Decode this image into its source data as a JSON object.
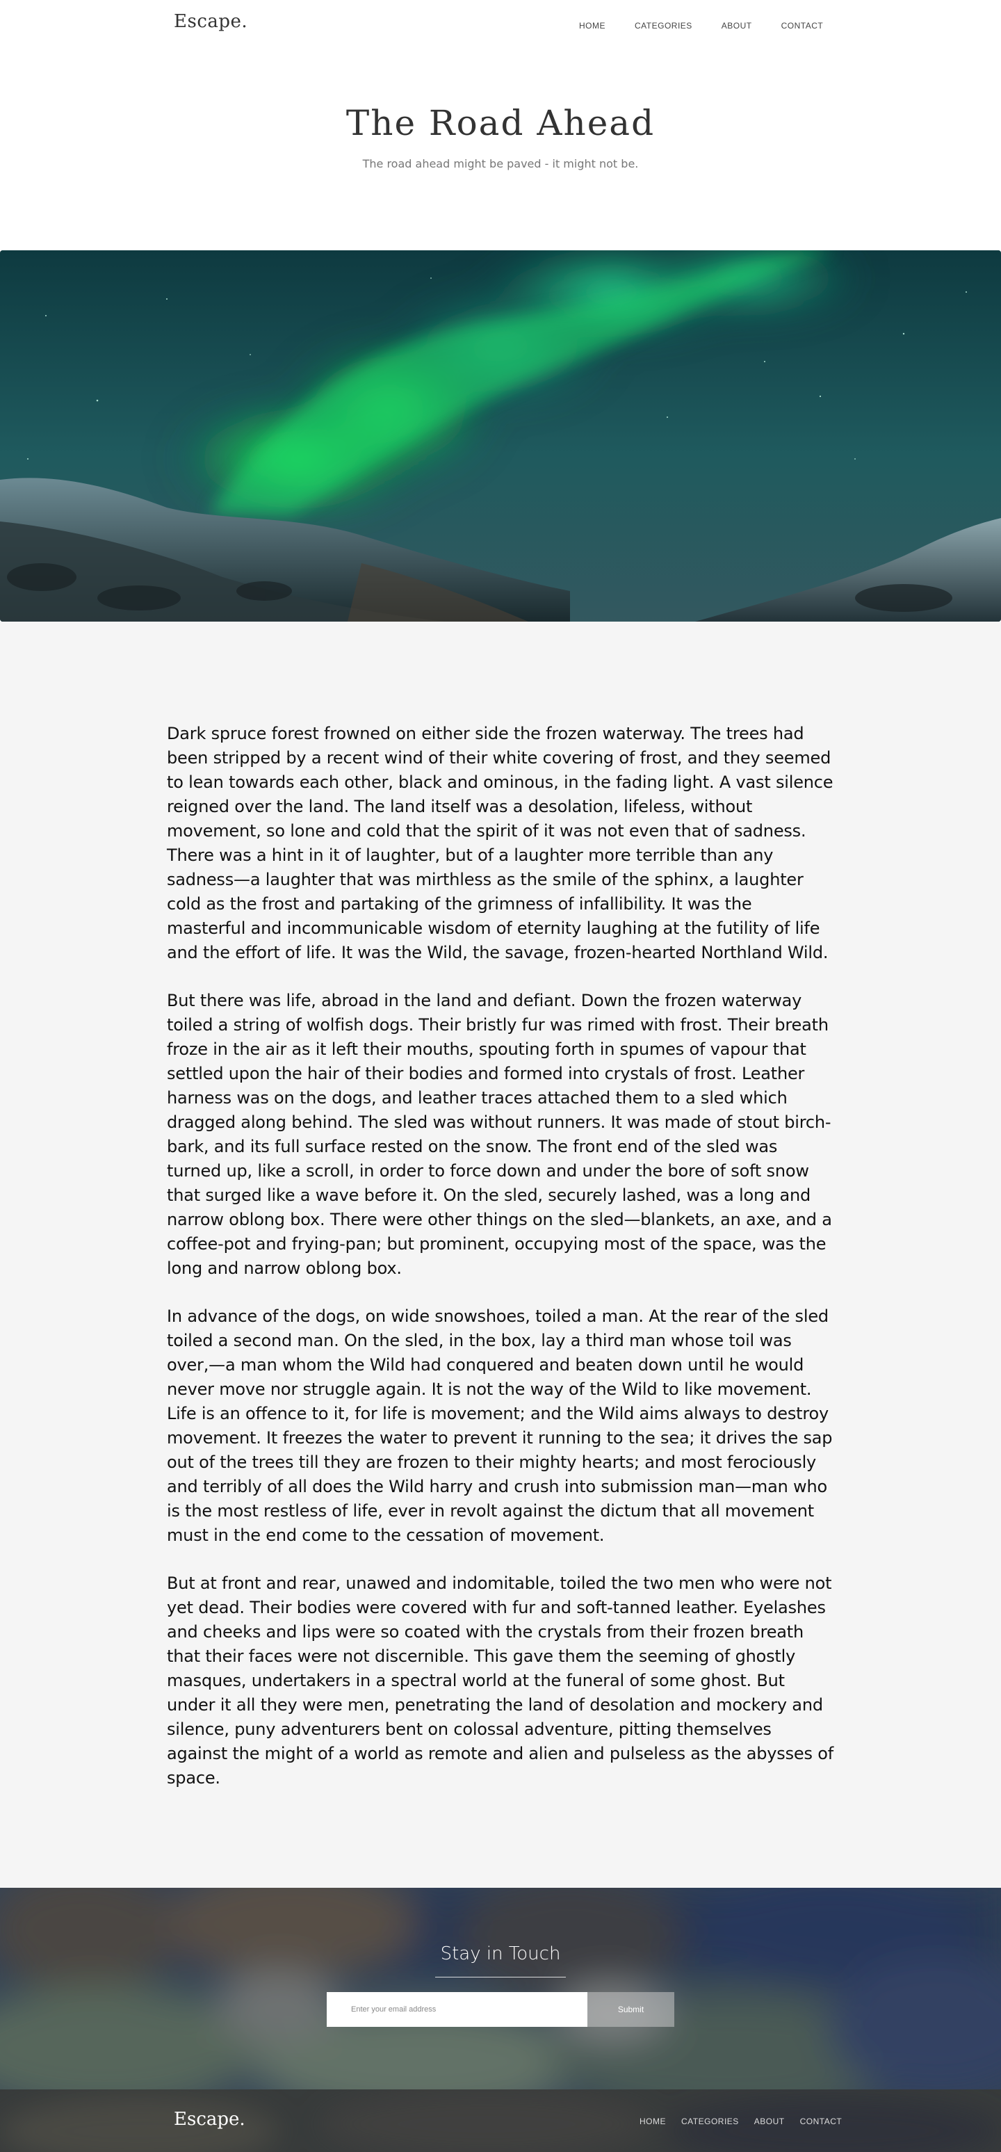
{
  "header": {
    "logo": "Escape.",
    "nav": [
      "HOME",
      "CATEGORIES",
      "ABOUT",
      "CONTACT"
    ]
  },
  "hero": {
    "title": "The Road Ahead",
    "subtitle": "The road ahead might be paved - it might not be."
  },
  "article": {
    "paragraphs": [
      "Dark spruce forest frowned on either side the frozen waterway. The trees had been stripped by a recent wind of their white covering of frost, and they seemed to lean towards each other, black and ominous, in the fading light. A vast silence reigned over the land. The land itself was a desolation, lifeless, without movement, so lone and cold that the spirit of it was not even that of sadness. There was a hint in it of laughter, but of a laughter more terrible than any sadness—a laughter that was mirthless as the smile of the sphinx, a laughter cold as the frost and partaking of the grimness of infallibility. It was the masterful and incommunicable wisdom of eternity laughing at the futility of life and the effort of life. It was the Wild, the savage, frozen-hearted Northland Wild.",
      "But there was life, abroad in the land and defiant. Down the frozen waterway toiled a string of wolfish dogs. Their bristly fur was rimed with frost. Their breath froze in the air as it left their mouths, spouting forth in spumes of vapour that settled upon the hair of their bodies and formed into crystals of frost. Leather harness was on the dogs, and leather traces attached them to a sled which dragged along behind. The sled was without runners. It was made of stout birch-bark, and its full surface rested on the snow. The front end of the sled was turned up, like a scroll, in order to force down and under the bore of soft snow that surged like a wave before it. On the sled, securely lashed, was a long and narrow oblong box. There were other things on the sled—blankets, an axe, and a coffee-pot and frying-pan; but prominent, occupying most of the space, was the long and narrow oblong box.",
      "In advance of the dogs, on wide snowshoes, toiled a man. At the rear of the sled toiled a second man. On the sled, in the box, lay a third man whose toil was over,—a man whom the Wild had conquered and beaten down until he would never move nor struggle again. It is not the way of the Wild to like movement. Life is an offence to it, for life is movement; and the Wild aims always to destroy movement. It freezes the water to prevent it running to the sea; it drives the sap out of the trees till they are frozen to their mighty hearts; and most ferociously and terribly of all does the Wild harry and crush into submission man—man who is the most restless of life, ever in revolt against the dictum that all movement must in the end come to the cessation of movement.",
      "But at front and rear, unawed and indomitable, toiled the two men who were not yet dead. Their bodies were covered with fur and soft-tanned leather. Eyelashes and cheeks and lips were so coated with the crystals from their frozen breath that their faces were not discernible. This gave them the seeming of ghostly masques, undertakers in a spectral world at the funeral of some ghost. But under it all they were men, penetrating the land of desolation and mockery and silence, puny adventurers bent on colossal adventure, pitting themselves against the might of a world as remote and alien and pulseless as the abysses of space."
    ]
  },
  "newsletter": {
    "title": "Stay in Touch",
    "email_placeholder": "Enter your email address",
    "submit_label": "Submit"
  },
  "footer": {
    "logo": "Escape.",
    "nav": [
      "HOME",
      "CATEGORIES",
      "ABOUT",
      "CONTACT"
    ]
  }
}
